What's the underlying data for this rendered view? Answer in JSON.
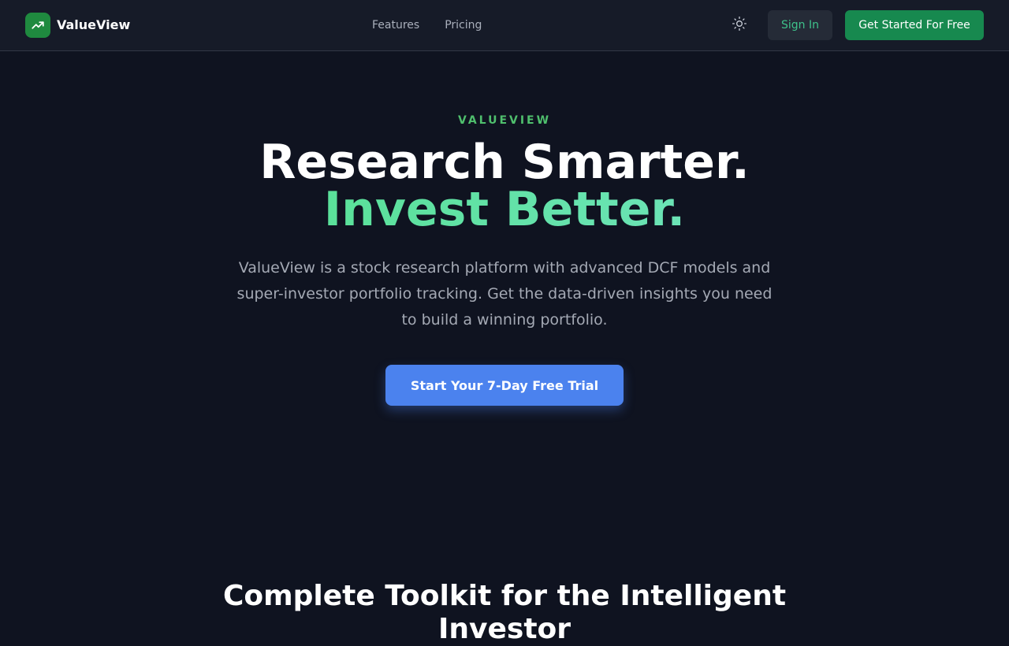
{
  "nav": {
    "brand": "ValueView",
    "links": [
      "Features",
      "Pricing"
    ],
    "sign_in_label": "Sign In",
    "get_started_label": "Get Started For Free",
    "theme_icon": "sun-icon"
  },
  "hero": {
    "eyebrow": "VALUEVIEW",
    "headline_line1": "Research Smarter.",
    "headline_line2": "Invest Better.",
    "description": "ValueView is a stock research platform with advanced DCF models and super-investor portfolio tracking. Get the data-driven insights you need to build a winning portfolio.",
    "cta_label": "Start Your 7-Day Free Trial"
  },
  "features": {
    "title": "Complete Toolkit for the Intelligent Investor"
  },
  "colors": {
    "background": "#0f1320",
    "navbar": "#161b28",
    "brand_green": "#1f8a3f",
    "accent_teal": "#5fe3b0",
    "cta_blue": "#4b82ee",
    "primary_button": "#17894f"
  }
}
